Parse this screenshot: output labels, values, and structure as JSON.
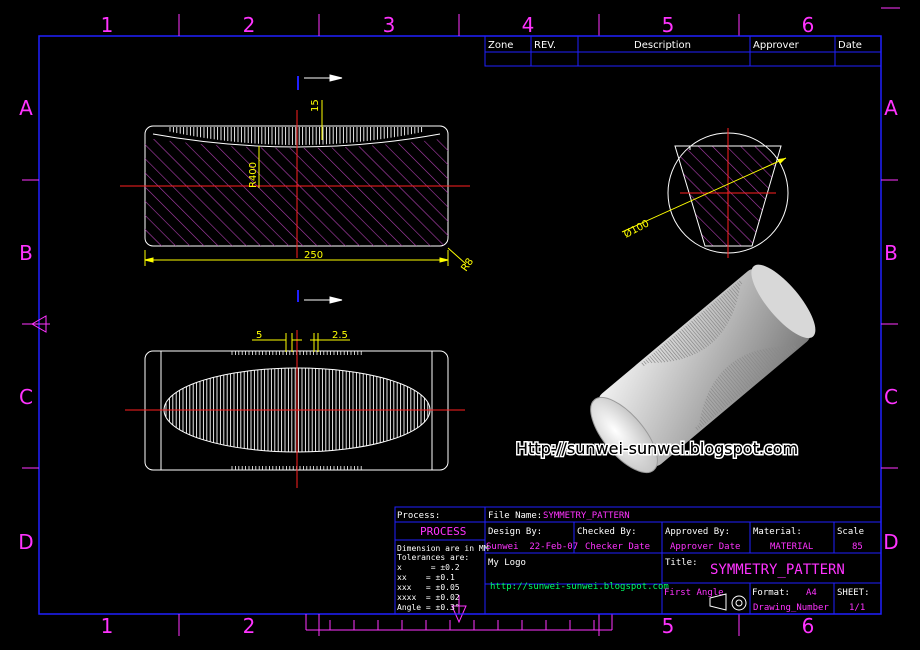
{
  "colors": {
    "frame": "#2020ff",
    "magenta": "#ff33ff",
    "white": "#ffffff",
    "yellow": "#ffff00",
    "red": "#ff2020",
    "hatch": "#c040c0"
  },
  "border": {
    "cols": [
      "1",
      "2",
      "3",
      "4",
      "5",
      "6"
    ],
    "rows": [
      "A",
      "B",
      "C",
      "D"
    ]
  },
  "revision": {
    "zone": "Zone",
    "rev": "REV.",
    "description": "Description",
    "approver": "Approver",
    "date": "Date"
  },
  "dims": {
    "d15": "15",
    "r400": "R400",
    "d250": "250",
    "r8": "R8",
    "d5": "5",
    "d25": "2.5",
    "dia100": "Ø100"
  },
  "watermark": "Http://sunwei-sunwei.blogspot.com",
  "titleblock": {
    "process_label": "Process:",
    "process_value": "PROCESS",
    "tol_title": "Dimension are in MM",
    "tol_sub": "Tolerances are:",
    "tol_lines": [
      "x      = ±0.2",
      "xx    = ±0.1",
      "xxx   = ±0.05",
      "xxxx  = ±0.02",
      "Angle = ±0.3°"
    ],
    "file_label": "File Name:",
    "file_value": "SYMMETRY_PATTERN",
    "design_label": "Design By:",
    "checked_label": "Checked By:",
    "design_value": "Sunwei  22-Feb-07",
    "checked_value": "Checker Date",
    "approved_label": "Approved By:",
    "approved_value": "Approver Date",
    "material_label": "Material:",
    "material_value": "MATERIAL",
    "scale_label": "Scale",
    "scale_value": "85",
    "logo_label": "My Logo",
    "logo_url": "http://sunwei-sunwei.blogspot.com",
    "title_label": "Title:",
    "title_value": "SYMMETRY_PATTERN",
    "angle_label": "First Angle",
    "format_label": "Format:",
    "format_value": "A4",
    "sheet_label": "SHEET:",
    "drawing_number": "Drawing_Number",
    "sheet_value": "1/1"
  }
}
